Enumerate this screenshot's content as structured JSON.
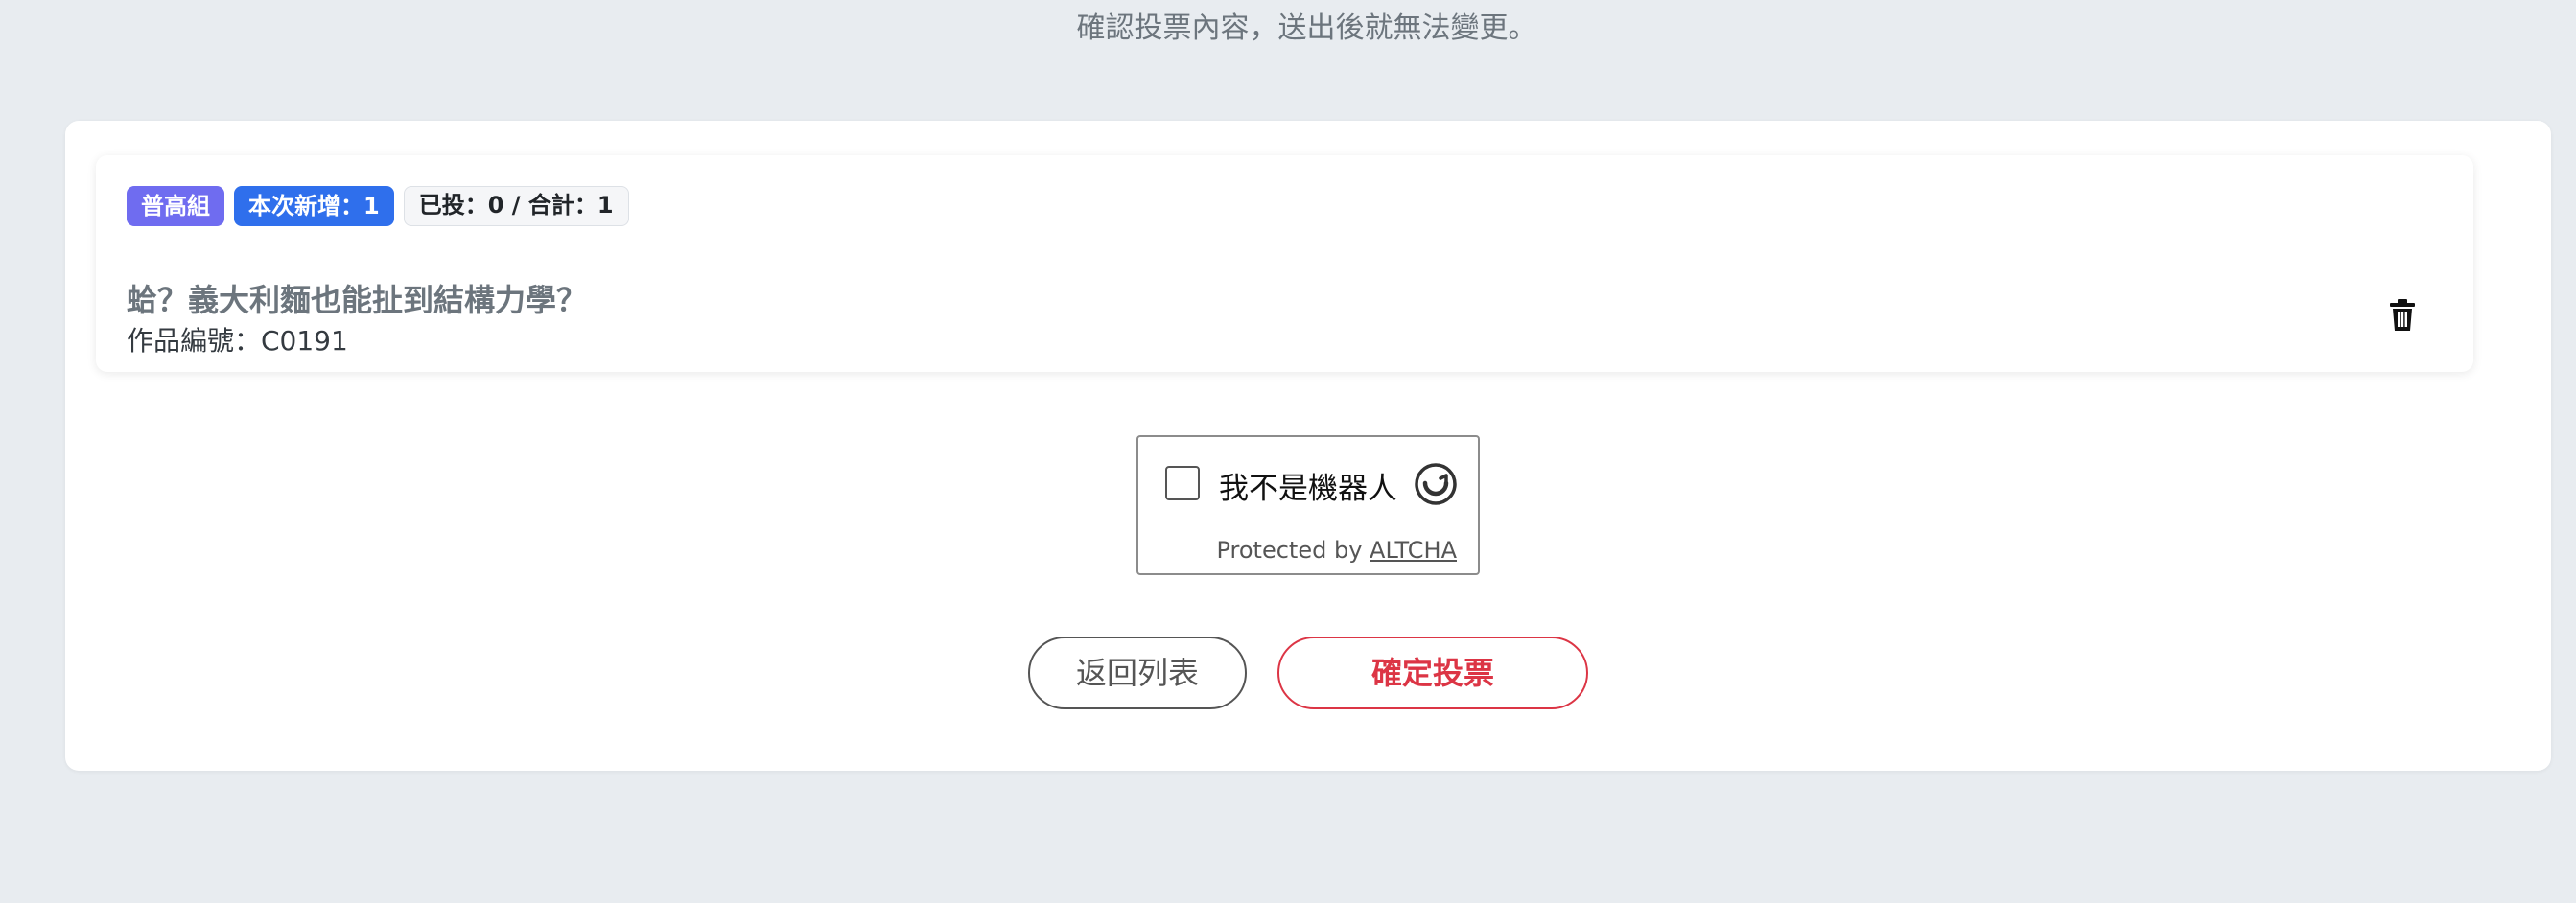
{
  "header": {
    "subtitle": "確認投票內容，送出後就無法變更。"
  },
  "item": {
    "badges": {
      "group": "普高組",
      "new": "本次新增：1",
      "count": "已投：0 / 合計：1"
    },
    "title": "蛤？義大利麵也能扯到結構力學？",
    "code": "作品編號：C0191",
    "delete_icon": "trash-icon"
  },
  "captcha": {
    "label": "我不是機器人",
    "footer_prefix": "Protected by",
    "footer_link": "ALTCHA",
    "checked": false
  },
  "actions": {
    "back_label": "返回列表",
    "confirm_label": "確定投票"
  },
  "colors": {
    "background": "#e8ecf0",
    "badge_group": "#6f6cf0",
    "badge_new": "#2f6fec",
    "danger": "#dc3545"
  }
}
